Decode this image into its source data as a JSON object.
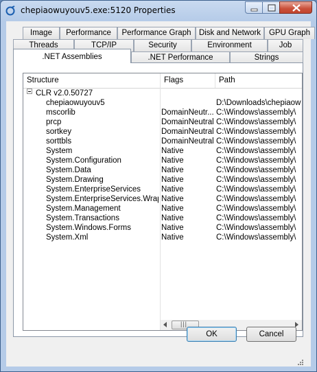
{
  "window": {
    "title": "chepiaowuyouv5.exe:5120 Properties"
  },
  "tabs": {
    "row1": [
      "Image",
      "Performance",
      "Performance Graph",
      "Disk and Network",
      "GPU Graph"
    ],
    "row2": [
      "Threads",
      "TCP/IP",
      "Security",
      "Environment",
      "Job"
    ],
    "row3": [
      ".NET Assemblies",
      ".NET Performance",
      "Strings"
    ],
    "active": ".NET Assemblies"
  },
  "tree": {
    "columns": [
      "Structure",
      "Flags",
      "Path"
    ],
    "root": "CLR v2.0.50727",
    "rows": [
      {
        "name": "chepiaowuyouv5",
        "flags": "",
        "path": "D:\\Downloads\\chepiaow"
      },
      {
        "name": "mscorlib",
        "flags": "DomainNeutr...",
        "path": "C:\\Windows\\assembly\\"
      },
      {
        "name": "prcp",
        "flags": "DomainNeutral",
        "path": "C:\\Windows\\assembly\\"
      },
      {
        "name": "sortkey",
        "flags": "DomainNeutral",
        "path": "C:\\Windows\\assembly\\"
      },
      {
        "name": "sorttbls",
        "flags": "DomainNeutral",
        "path": "C:\\Windows\\assembly\\"
      },
      {
        "name": "System",
        "flags": "Native",
        "path": "C:\\Windows\\assembly\\"
      },
      {
        "name": "System.Configuration",
        "flags": "Native",
        "path": "C:\\Windows\\assembly\\"
      },
      {
        "name": "System.Data",
        "flags": "Native",
        "path": "C:\\Windows\\assembly\\"
      },
      {
        "name": "System.Drawing",
        "flags": "Native",
        "path": "C:\\Windows\\assembly\\"
      },
      {
        "name": "System.EnterpriseServices",
        "flags": "Native",
        "path": "C:\\Windows\\assembly\\"
      },
      {
        "name": "System.EnterpriseServices.Wrap...",
        "flags": "Native",
        "path": "C:\\Windows\\assembly\\"
      },
      {
        "name": "System.Management",
        "flags": "Native",
        "path": "C:\\Windows\\assembly\\"
      },
      {
        "name": "System.Transactions",
        "flags": "Native",
        "path": "C:\\Windows\\assembly\\"
      },
      {
        "name": "System.Windows.Forms",
        "flags": "Native",
        "path": "C:\\Windows\\assembly\\"
      },
      {
        "name": "System.Xml",
        "flags": "Native",
        "path": "C:\\Windows\\assembly\\"
      }
    ]
  },
  "buttons": {
    "ok": "OK",
    "cancel": "Cancel"
  },
  "icons": {
    "app": "process-icon",
    "minimize": "minimize-icon",
    "maximize": "maximize-icon",
    "close": "close-icon",
    "collapse": "collapse-icon",
    "resize": "resize-grip-icon"
  }
}
